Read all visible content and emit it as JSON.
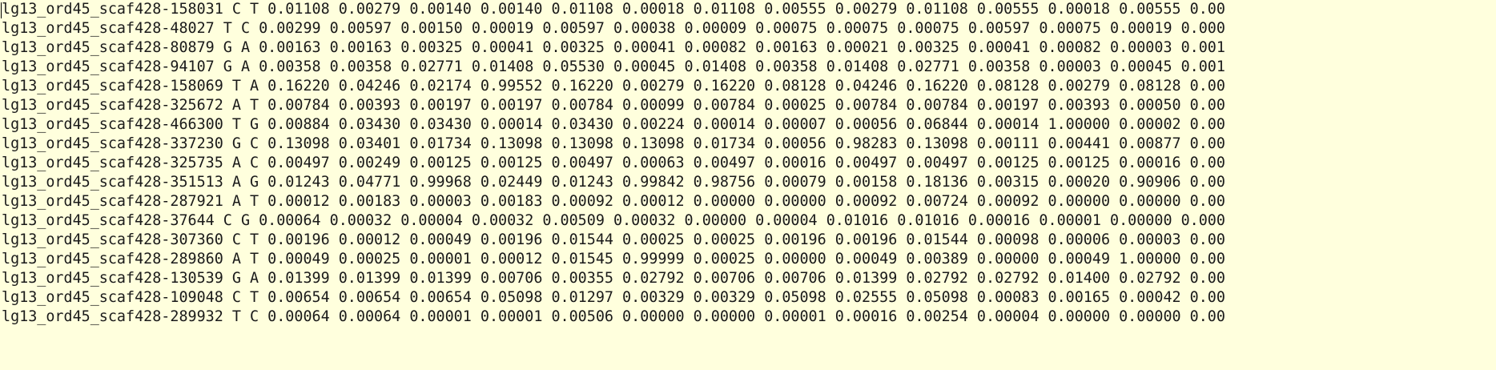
{
  "lines": [
    "lg13_ord45_scaf428-158031 C T 0.01108 0.00279 0.00140 0.00140 0.01108 0.00018 0.01108 0.00555 0.00279 0.01108 0.00555 0.00018 0.00555 0.00",
    "lg13_ord45_scaf428-48027 T C 0.00299 0.00597 0.00150 0.00019 0.00597 0.00038 0.00009 0.00075 0.00075 0.00075 0.00597 0.00075 0.00019 0.000",
    "lg13_ord45_scaf428-80879 G A 0.00163 0.00163 0.00325 0.00041 0.00325 0.00041 0.00082 0.00163 0.00021 0.00325 0.00041 0.00082 0.00003 0.001",
    "lg13_ord45_scaf428-94107 G A 0.00358 0.00358 0.02771 0.01408 0.05530 0.00045 0.01408 0.00358 0.01408 0.02771 0.00358 0.00003 0.00045 0.001",
    "lg13_ord45_scaf428-158069 T A 0.16220 0.04246 0.02174 0.99552 0.16220 0.00279 0.16220 0.08128 0.04246 0.16220 0.08128 0.00279 0.08128 0.00",
    "lg13_ord45_scaf428-325672 A T 0.00784 0.00393 0.00197 0.00197 0.00784 0.00099 0.00784 0.00025 0.00784 0.00784 0.00197 0.00393 0.00050 0.00",
    "lg13_ord45_scaf428-466300 T G 0.00884 0.03430 0.03430 0.00014 0.03430 0.00224 0.00014 0.00007 0.00056 0.06844 0.00014 1.00000 0.00002 0.00",
    "lg13_ord45_scaf428-337230 G C 0.13098 0.03401 0.01734 0.13098 0.13098 0.13098 0.01734 0.00056 0.98283 0.13098 0.00111 0.00441 0.00877 0.00",
    "lg13_ord45_scaf428-325735 A C 0.00497 0.00249 0.00125 0.00125 0.00497 0.00063 0.00497 0.00016 0.00497 0.00497 0.00125 0.00125 0.00016 0.00",
    "lg13_ord45_scaf428-351513 A G 0.01243 0.04771 0.99968 0.02449 0.01243 0.99842 0.98756 0.00079 0.00158 0.18136 0.00315 0.00020 0.90906 0.00",
    "lg13_ord45_scaf428-287921 A T 0.00012 0.00183 0.00003 0.00183 0.00092 0.00012 0.00000 0.00000 0.00092 0.00724 0.00092 0.00000 0.00000 0.00",
    "lg13_ord45_scaf428-37644 C G 0.00064 0.00032 0.00004 0.00032 0.00509 0.00032 0.00000 0.00004 0.01016 0.01016 0.00016 0.00001 0.00000 0.000",
    "lg13_ord45_scaf428-307360 C T 0.00196 0.00012 0.00049 0.00196 0.01544 0.00025 0.00025 0.00196 0.00196 0.01544 0.00098 0.00006 0.00003 0.00",
    "lg13_ord45_scaf428-289860 A T 0.00049 0.00025 0.00001 0.00012 0.01545 0.99999 0.00025 0.00000 0.00049 0.00389 0.00000 0.00049 1.00000 0.00",
    "lg13_ord45_scaf428-130539 G A 0.01399 0.01399 0.01399 0.00706 0.00355 0.02792 0.00706 0.00706 0.01399 0.02792 0.02792 0.01400 0.02792 0.00",
    "lg13_ord45_scaf428-109048 C T 0.00654 0.00654 0.00654 0.05098 0.01297 0.00329 0.00329 0.05098 0.02555 0.05098 0.00083 0.00165 0.00042 0.00",
    "lg13_ord45_scaf428-289932 T C 0.00064 0.00064 0.00001 0.00001 0.00506 0.00000 0.00000 0.00001 0.00016 0.00254 0.00004 0.00000 0.00000 0.00"
  ]
}
